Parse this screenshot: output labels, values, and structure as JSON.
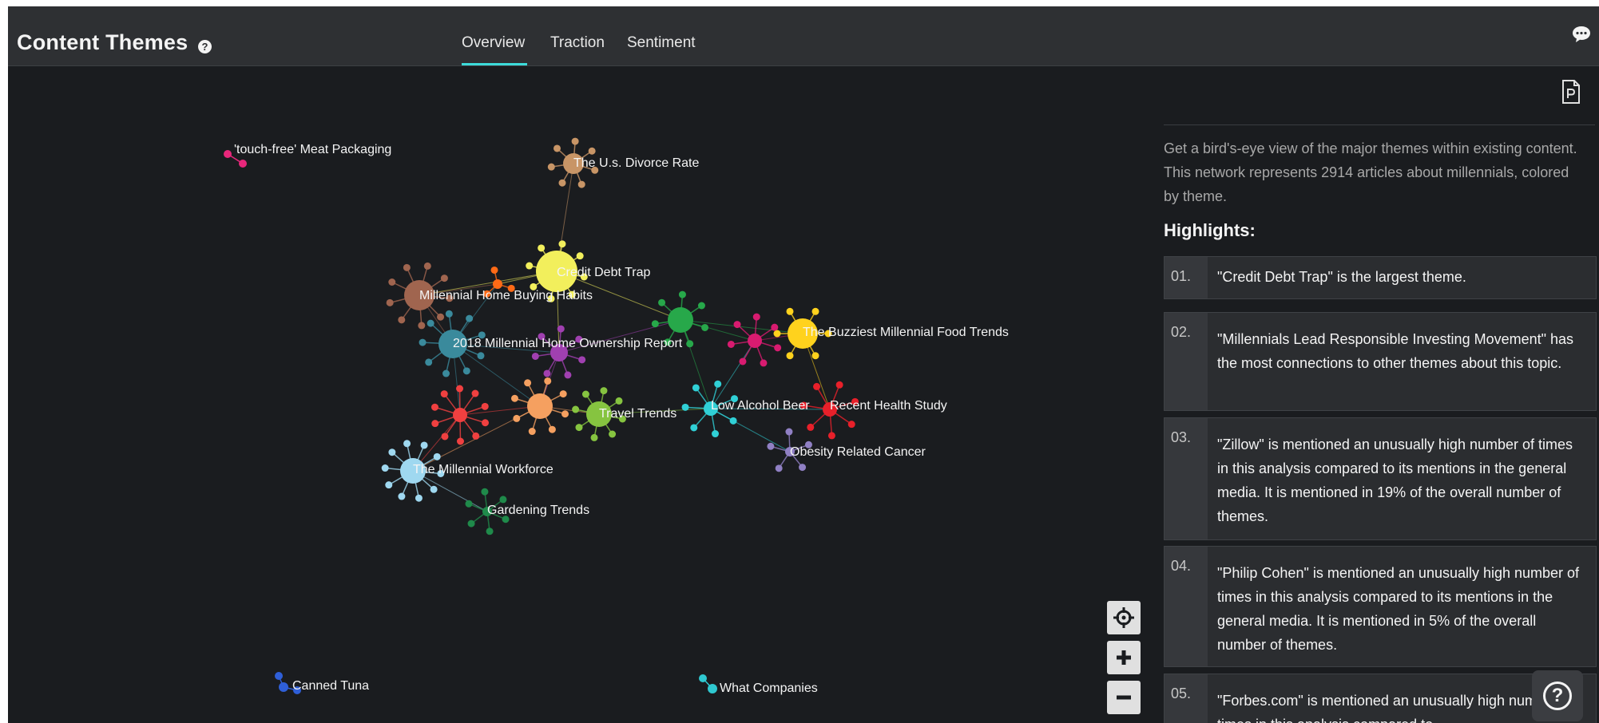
{
  "header": {
    "title": "Content Themes",
    "help_icon": "question-circle-icon",
    "tabs": [
      {
        "label": "Overview",
        "active": true
      },
      {
        "label": "Traction",
        "active": false
      },
      {
        "label": "Sentiment",
        "active": false
      }
    ],
    "chat_icon": "chat-bubble-icon"
  },
  "colors": {
    "background": "#1a1c1f",
    "header": "#2e3033",
    "accent": "#3ddbd9"
  },
  "network": {
    "themes": [
      {
        "label": "'touch-free' Meat Packaging",
        "color": "#e8277b"
      },
      {
        "label": "The U.s. Divorce Rate",
        "color": "#c89566"
      },
      {
        "label": "Credit Debt Trap",
        "color": "#f2ef5c"
      },
      {
        "label": "Millennial Home Buying Habits",
        "color": "#a0654f"
      },
      {
        "label": "2018 Millennial Home Ownership Report",
        "color": "#3a8a9c"
      },
      {
        "label": "The Buzziest Millennial Food Trends",
        "color": "#ffd21d"
      },
      {
        "label": "Travel Trends",
        "color": "#86c440"
      },
      {
        "label": "Low Alcohol Beer",
        "color": "#30d0d6"
      },
      {
        "label": "Recent Health Study",
        "color": "#e8202a"
      },
      {
        "label": "Obesity Related Cancer",
        "color": "#9080c4"
      },
      {
        "label": "The Millennial Workforce",
        "color": "#9fd8f0"
      },
      {
        "label": "Gardening Trends",
        "color": "#1f8a4a"
      },
      {
        "label": "Canned Tuna",
        "color": "#2f5fd8"
      },
      {
        "label": "What Companies",
        "color": "#2fc8d0"
      }
    ]
  },
  "controls": {
    "recenter_icon": "crosshair-icon",
    "zoom_in_icon": "plus-icon",
    "zoom_out_icon": "minus-icon"
  },
  "panel": {
    "pdf_icon": "pdf-icon",
    "description": "Get a bird's-eye view of the major themes within existing content. This network represents 2914 articles about millennials, colored by theme.",
    "highlights_heading": "Highlights:",
    "highlights": [
      {
        "num": "01.",
        "text": "\"Credit Debt Trap\" is the largest theme."
      },
      {
        "num": "02.",
        "text": "\"Millennials Lead Responsible Investing Movement\" has the most connections to other themes about this topic."
      },
      {
        "num": "03.",
        "text": "\"Zillow\" is mentioned an unusually high number of times in this analysis compared to its mentions in the general media. It is mentioned in 19% of the overall number of themes."
      },
      {
        "num": "04.",
        "text": "\"Philip Cohen\" is mentioned an unusually high number of times in this analysis compared to its mentions in the general media. It is mentioned in 5% of the overall number of themes."
      },
      {
        "num": "05.",
        "text": "\"Forbes.com\" is mentioned an unusually high number of times in this analysis compared to"
      }
    ],
    "help_button_icon": "question-circle-icon"
  }
}
